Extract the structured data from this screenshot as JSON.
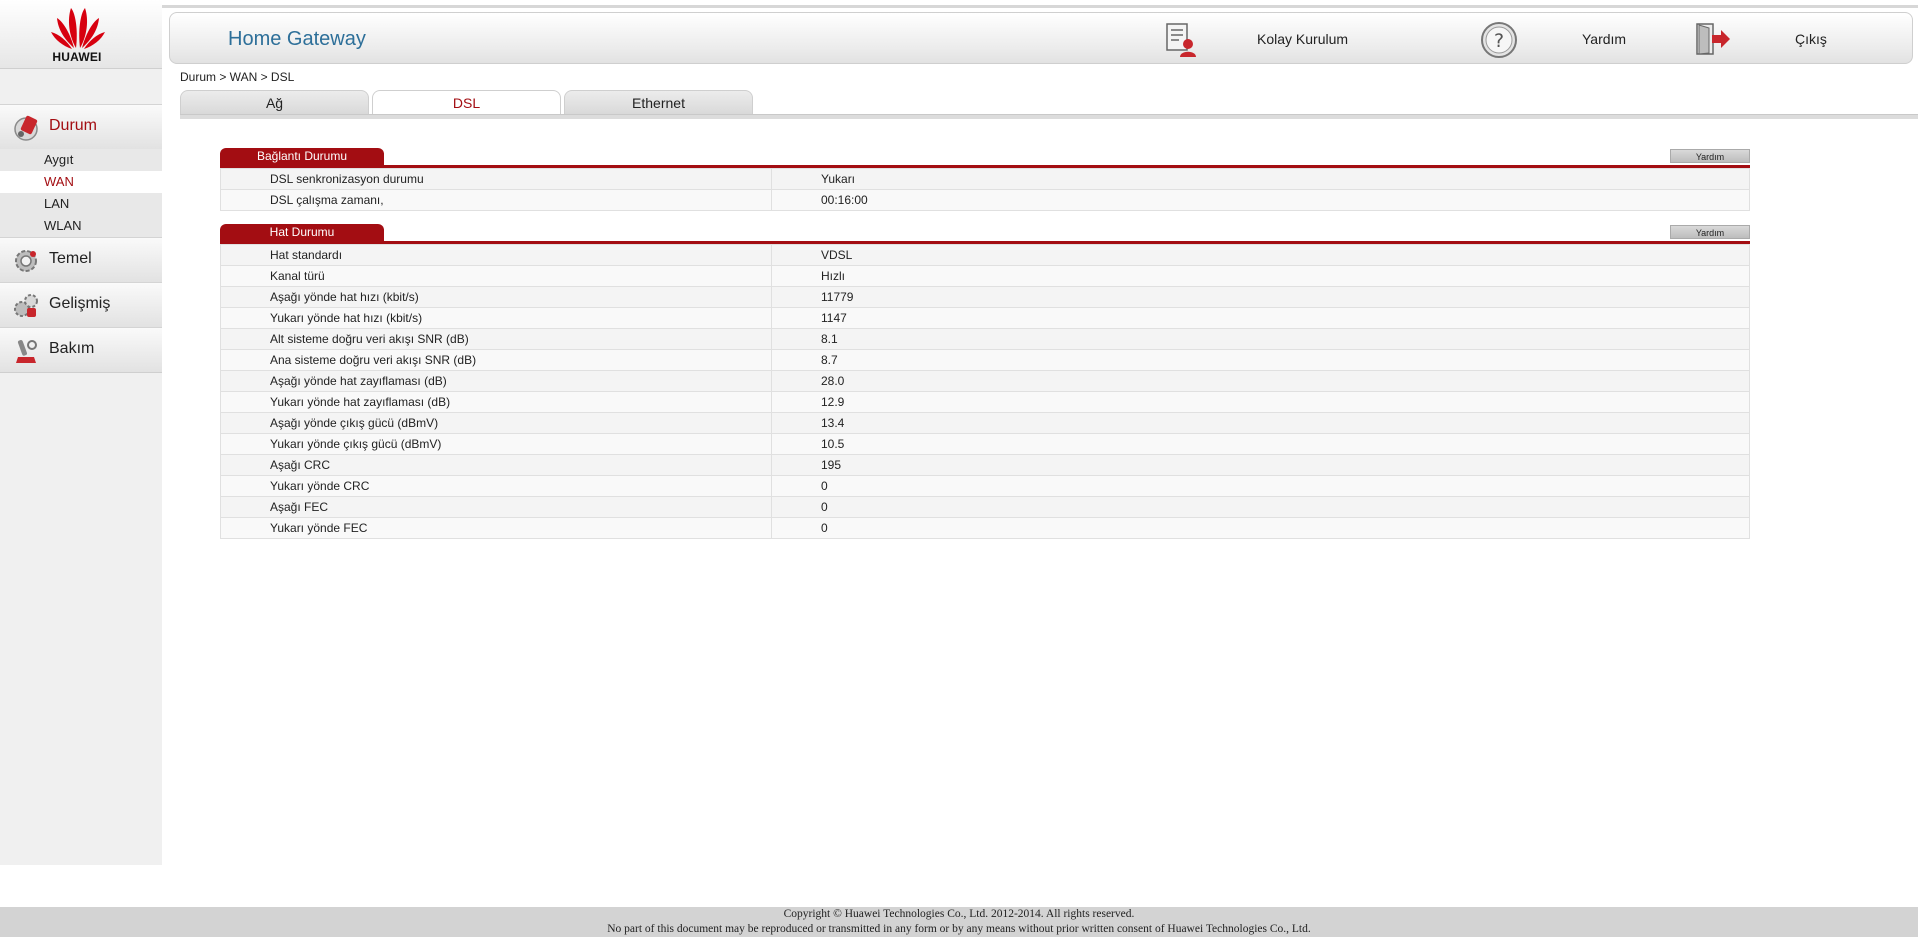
{
  "brand": {
    "logo_text": "HUAWEI",
    "accent": "#a30d12",
    "title_color": "#2d6f99"
  },
  "header": {
    "title": "Home Gateway",
    "quick_setup": {
      "label": "Kolay Kurulum",
      "icon": "quick-setup-icon"
    },
    "help": {
      "label": "Yardım",
      "icon": "help-icon"
    },
    "logout": {
      "label": "Çıkış",
      "icon": "logout-icon"
    }
  },
  "sidebar": {
    "items": [
      {
        "label": "Durum",
        "icon": "status-icon",
        "active": true
      },
      {
        "label": "Temel",
        "icon": "basic-settings-icon"
      },
      {
        "label": "Gelişmiş",
        "icon": "advanced-settings-icon"
      },
      {
        "label": "Bakım",
        "icon": "maintenance-icon"
      }
    ],
    "sub_items": [
      {
        "label": "Aygıt"
      },
      {
        "label": "WAN",
        "active": true
      },
      {
        "label": "LAN"
      },
      {
        "label": "WLAN"
      }
    ]
  },
  "breadcrumb": "Durum > WAN > DSL",
  "tabs": [
    {
      "label": "Ağ"
    },
    {
      "label": "DSL",
      "active": true
    },
    {
      "label": "Ethernet"
    }
  ],
  "connection_status": {
    "title": "Bağlantı Durumu",
    "help_label": "Yardım",
    "rows": [
      {
        "key": "DSL senkronizasyon durumu",
        "value": "Yukarı"
      },
      {
        "key": "DSL çalışma zamanı,",
        "value": "00:16:00"
      }
    ]
  },
  "line_status": {
    "title": "Hat Durumu",
    "help_label": "Yardım",
    "rows": [
      {
        "key": "Hat standardı",
        "value": "VDSL"
      },
      {
        "key": "Kanal türü",
        "value": "Hızlı"
      },
      {
        "key": "Aşağı yönde hat hızı (kbit/s)",
        "value": "11779"
      },
      {
        "key": "Yukarı yönde hat hızı (kbit/s)",
        "value": "1147"
      },
      {
        "key": "Alt sisteme doğru veri akışı SNR (dB)",
        "value": "8.1"
      },
      {
        "key": "Ana sisteme doğru veri akışı SNR (dB)",
        "value": "8.7"
      },
      {
        "key": "Aşağı yönde hat zayıflaması (dB)",
        "value": "28.0"
      },
      {
        "key": "Yukarı yönde hat zayıflaması (dB)",
        "value": "12.9"
      },
      {
        "key": "Aşağı yönde çıkış gücü (dBmV)",
        "value": "13.4"
      },
      {
        "key": "Yukarı yönde çıkış gücü (dBmV)",
        "value": "10.5"
      },
      {
        "key": "Aşağı CRC",
        "value": "195"
      },
      {
        "key": "Yukarı yönde CRC",
        "value": "0"
      },
      {
        "key": "Aşağı FEC",
        "value": "0"
      },
      {
        "key": "Yukarı yönde FEC",
        "value": "0"
      }
    ]
  },
  "footer": {
    "line1": "Copyright © Huawei Technologies Co., Ltd. 2012-2014. All rights reserved.",
    "line2": "No part of this document may be reproduced or transmitted in any form or by any means without prior written consent of Huawei Technologies Co., Ltd."
  }
}
